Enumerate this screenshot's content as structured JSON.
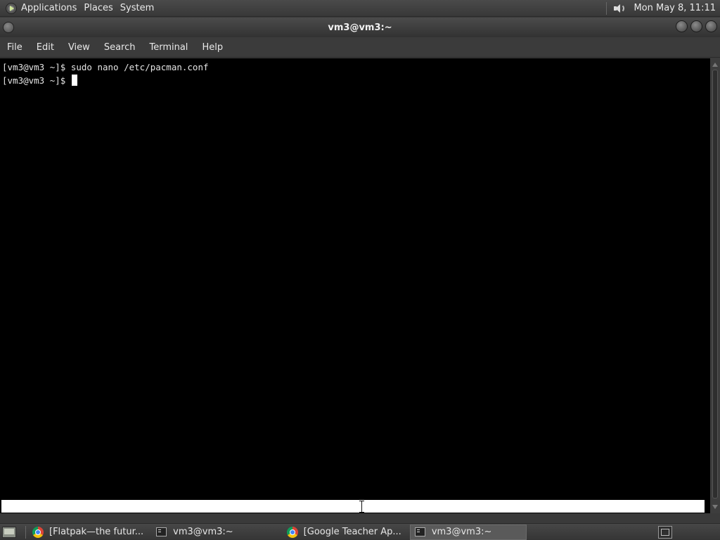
{
  "top_panel": {
    "menus": [
      "Applications",
      "Places",
      "System"
    ],
    "clock": "Mon May  8, 11:11"
  },
  "window": {
    "title": "vm3@vm3:~",
    "menus": [
      "File",
      "Edit",
      "View",
      "Search",
      "Terminal",
      "Help"
    ]
  },
  "terminal": {
    "lines": [
      "[vm3@vm3 ~]$ sudo nano /etc/pacman.conf",
      "[vm3@vm3 ~]$ "
    ]
  },
  "taskbar": {
    "tasks": [
      {
        "label": "[Flatpak—the futur...",
        "icon": "chrome-icon",
        "active": false
      },
      {
        "label": "vm3@vm3:~",
        "icon": "terminal-icon",
        "active": false
      },
      {
        "label": "[Google Teacher Ap...",
        "icon": "chrome-icon",
        "active": false
      },
      {
        "label": "vm3@vm3:~",
        "icon": "terminal-icon",
        "active": true
      }
    ]
  },
  "colors": {
    "panel_bg": "#3b3b3b",
    "terminal_bg": "#000000",
    "terminal_fg": "#e5e5e5"
  }
}
